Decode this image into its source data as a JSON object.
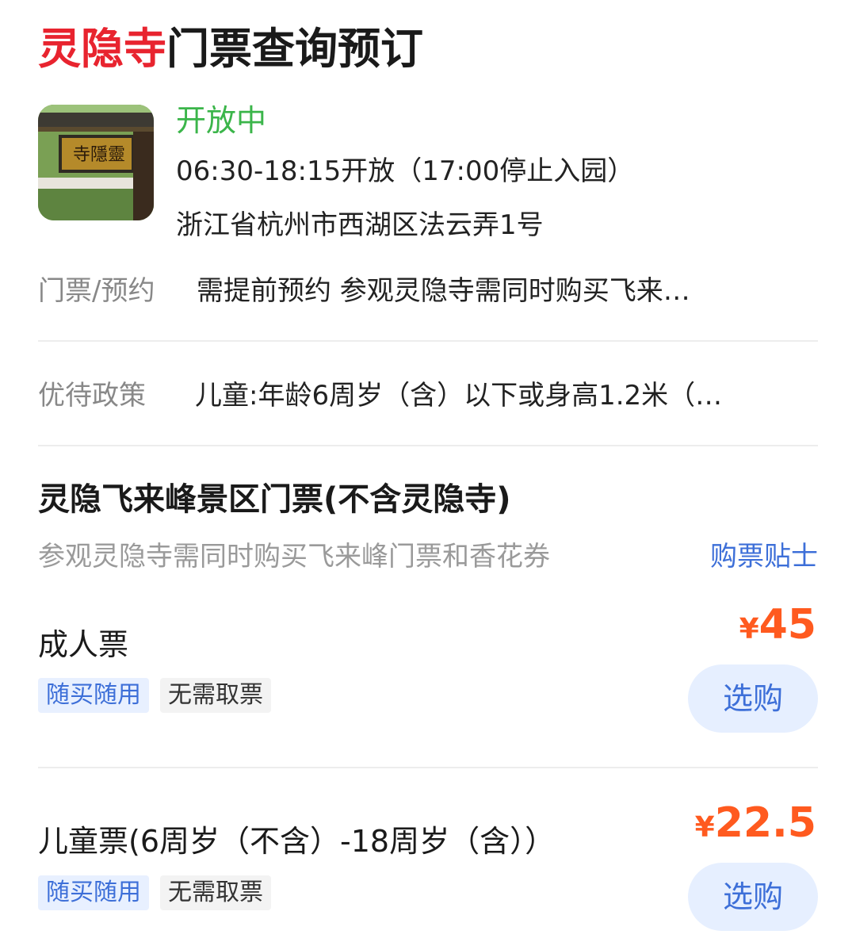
{
  "header": {
    "title_highlight": "灵隐寺",
    "title_rest": "门票查询预订"
  },
  "info": {
    "status": "开放中",
    "hours": "06:30-18:15开放（17:00停止入园）",
    "address": "浙江省杭州市西湖区法云弄1号"
  },
  "rows": {
    "ticket_label": "门票/预约",
    "ticket_value": "需提前预约  参观灵隐寺需同时购买飞来…",
    "policy_label": "优待政策",
    "policy_value": "儿童:年龄6周岁（含）以下或身高1.2米（…"
  },
  "section": {
    "title": "灵隐飞来峰景区门票(不含灵隐寺)",
    "note": "参观灵隐寺需同时购买飞来峰门票和香花券",
    "tips_link": "购票贴士"
  },
  "tickets": [
    {
      "name": "成人票",
      "tags": [
        "随买随用",
        "无需取票"
      ],
      "currency": "¥",
      "price": "45",
      "button": "选购"
    },
    {
      "name": "儿童票(6周岁（不含）-18周岁（含））",
      "tags": [
        "随买随用",
        "无需取票"
      ],
      "currency": "¥",
      "price": "22.5",
      "button": "选购"
    }
  ],
  "colors": {
    "highlight_red": "#e8242f",
    "status_green": "#3bb54a",
    "price_orange": "#ff5a1f",
    "link_blue": "#3d6fd8"
  }
}
